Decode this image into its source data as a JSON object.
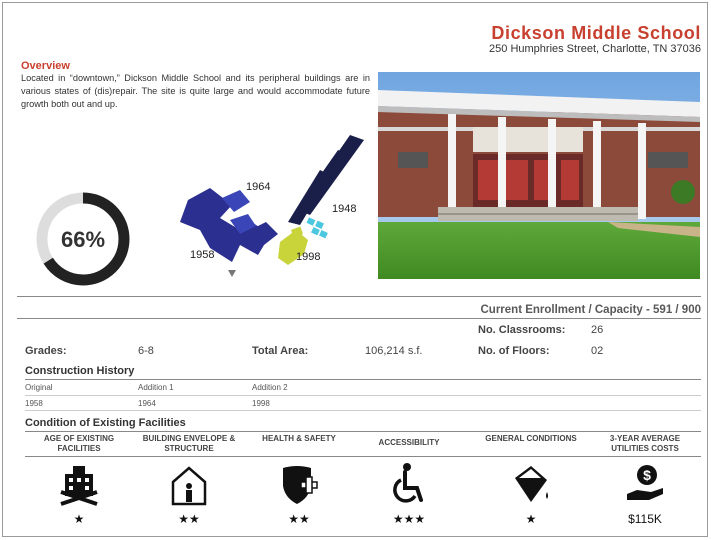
{
  "header": {
    "school_name": "Dickson Middle School",
    "address": "250 Humphries Street, Charlotte, TN 37036"
  },
  "overview": {
    "heading": "Overview",
    "text": "Located in “downtown,” Dickson Middle School and its peripheral buildings are in various states of (dis)repair. The site is quite large and would accommodate future growth both out and up."
  },
  "condition_score": {
    "percent_label": "66%",
    "percent_value": 0.66
  },
  "site_plan": {
    "labels": {
      "b1964": "1964",
      "b1948": "1948",
      "b1958": "1958",
      "b1998": "1998"
    },
    "colors": {
      "y1958": "#2b2f8f",
      "y1964": "#3a46b7",
      "y1948": "#1a1f4a",
      "y1998": "#c8d43a",
      "annex": "#4bc8e0"
    }
  },
  "enrollment": {
    "text": "Current Enrollment / Capacity  - 591 / 900"
  },
  "facts": {
    "classrooms_label": "No. Classrooms:",
    "classrooms_value": "26",
    "grades_label": "Grades:",
    "grades_value": "6-8",
    "area_label": "Total Area:",
    "area_value": "106,214 s.f.",
    "floors_label": "No. of Floors:",
    "floors_value": "02"
  },
  "construction": {
    "heading": "Construction History",
    "headers": [
      "Original",
      "Addition 1",
      "Addition 2"
    ],
    "years": [
      "1958",
      "1964",
      "1998"
    ]
  },
  "condition": {
    "heading": "Condition of Existing Facilities",
    "categories": [
      {
        "label": "AGE OF EXISTING FACILITIES",
        "icon": "building-age-icon",
        "rating": "★"
      },
      {
        "label": "BUILDING ENVELOPE & STRUCTURE",
        "icon": "house-person-icon",
        "rating": "★★"
      },
      {
        "label": "HEALTH & SAFETY",
        "icon": "shield-cross-icon",
        "rating": "★★"
      },
      {
        "label": "ACCESSIBILITY",
        "icon": "wheelchair-icon",
        "rating": "★★★"
      },
      {
        "label": "GENERAL CONDITIONS",
        "icon": "paint-bucket-icon",
        "rating": "★"
      },
      {
        "label": "3-YEAR AVERAGE UTILITIES COSTS",
        "icon": "dollar-hand-icon",
        "rating": "$115K"
      }
    ]
  },
  "colors": {
    "accent": "#c8402f",
    "pie_fill": "#222222",
    "pie_track": "#dddddd"
  }
}
